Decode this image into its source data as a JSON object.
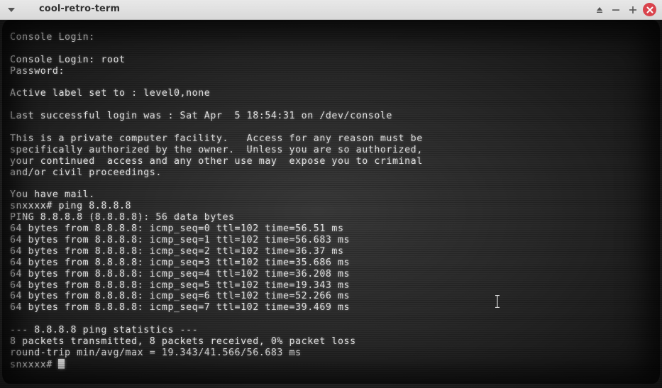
{
  "window": {
    "title": "cool-retro-term"
  },
  "titlebar": {
    "menu_icon": "chevron-down-icon",
    "controls": [
      "shade-icon",
      "minimize-icon",
      "maximize-icon",
      "close-icon"
    ],
    "close_color": "#d9434c"
  },
  "terminal": {
    "text_color": "#e6e6e6",
    "lines": [
      "Console Login:",
      "",
      "Console Login: root",
      "Password:",
      "",
      "Active label set to : level0,none",
      "",
      "Last successful login was : Sat Apr  5 18:54:31 on /dev/console",
      "",
      "This is a private computer facility.   Access for any reason must be",
      "specifically authorized by the owner.  Unless you are so authorized,",
      "your continued  access and any other use may  expose you to criminal",
      "and/or civil proceedings.",
      "",
      "You have mail.",
      "snxxxx# ping 8.8.8.8",
      "PING 8.8.8.8 (8.8.8.8): 56 data bytes",
      "64 bytes from 8.8.8.8: icmp_seq=0 ttl=102 time=56.51 ms",
      "64 bytes from 8.8.8.8: icmp_seq=1 ttl=102 time=56.683 ms",
      "64 bytes from 8.8.8.8: icmp_seq=2 ttl=102 time=36.37 ms",
      "64 bytes from 8.8.8.8: icmp_seq=3 ttl=102 time=35.686 ms",
      "64 bytes from 8.8.8.8: icmp_seq=4 ttl=102 time=36.208 ms",
      "64 bytes from 8.8.8.8: icmp_seq=5 ttl=102 time=19.343 ms",
      "64 bytes from 8.8.8.8: icmp_seq=6 ttl=102 time=52.266 ms",
      "64 bytes from 8.8.8.8: icmp_seq=7 ttl=102 time=39.469 ms",
      "",
      "--- 8.8.8.8 ping statistics ---",
      "8 packets transmitted, 8 packets received, 0% packet loss",
      "round-trip min/avg/max = 19.343/41.566/56.683 ms"
    ],
    "prompt": "snxxxx# "
  }
}
